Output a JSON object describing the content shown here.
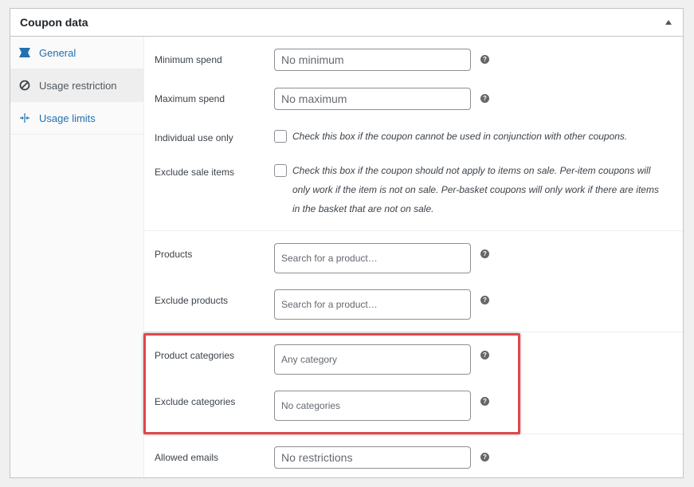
{
  "panel": {
    "title": "Coupon data"
  },
  "tabs": [
    {
      "label": "General",
      "icon": "ticket-icon"
    },
    {
      "label": "Usage restriction",
      "icon": "no-entry-icon"
    },
    {
      "label": "Usage limits",
      "icon": "arrows-icon"
    }
  ],
  "fields": {
    "minimum_spend": {
      "label": "Minimum spend",
      "placeholder": "No minimum"
    },
    "maximum_spend": {
      "label": "Maximum spend",
      "placeholder": "No maximum"
    },
    "individual_use": {
      "label": "Individual use only",
      "description": "Check this box if the coupon cannot be used in conjunction with other coupons."
    },
    "exclude_sale": {
      "label": "Exclude sale items",
      "description": "Check this box if the coupon should not apply to items on sale. Per-item coupons will only work if the item is not on sale. Per-basket coupons will only work if there are items in the basket that are not on sale."
    },
    "products": {
      "label": "Products",
      "placeholder": "Search for a product…"
    },
    "exclude_products": {
      "label": "Exclude products",
      "placeholder": "Search for a product…"
    },
    "product_categories": {
      "label": "Product categories",
      "placeholder": "Any category"
    },
    "exclude_categories": {
      "label": "Exclude categories",
      "placeholder": "No categories"
    },
    "allowed_emails": {
      "label": "Allowed emails",
      "placeholder": "No restrictions"
    }
  },
  "help_glyph": "?",
  "colors": {
    "highlight": "#e0474c",
    "link": "#2271b1"
  }
}
